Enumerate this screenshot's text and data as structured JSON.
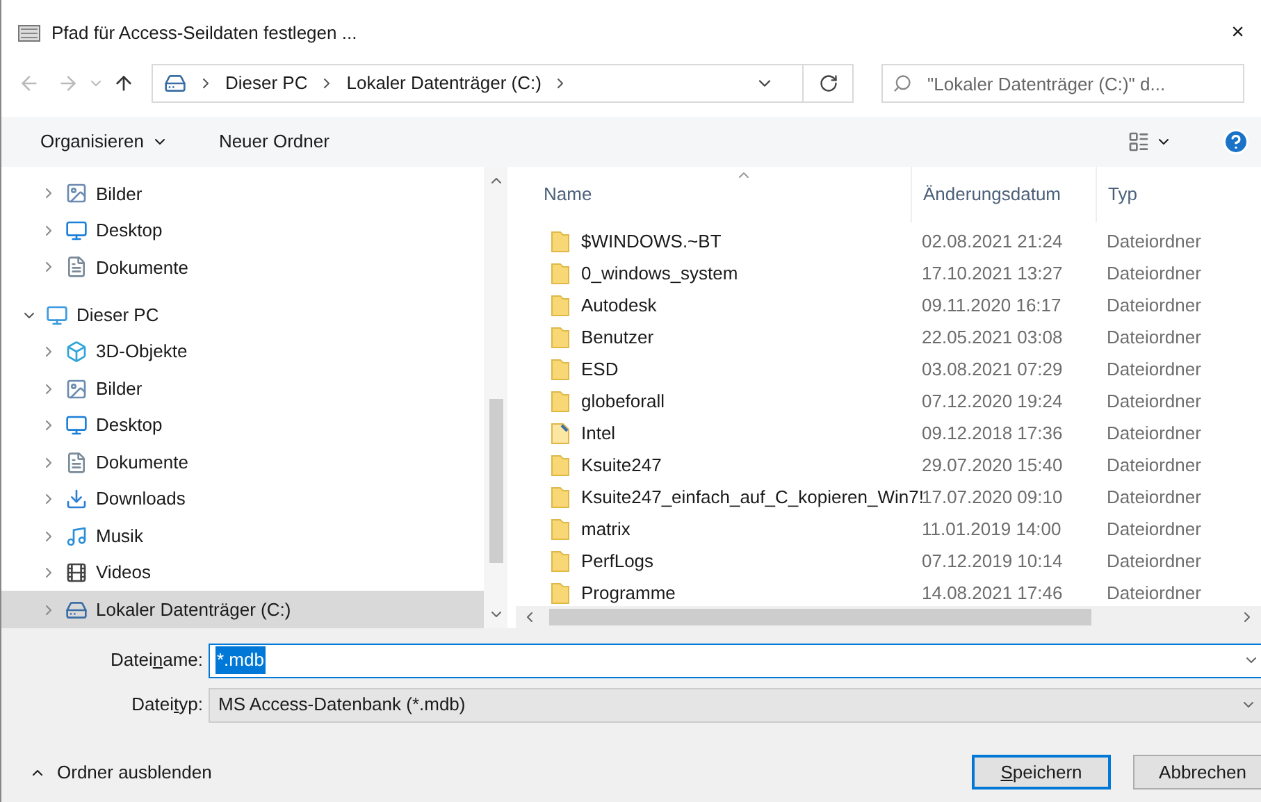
{
  "window": {
    "title": "Pfad für Access-Seildaten festlegen ...",
    "close": "×"
  },
  "address": {
    "crumbs": [
      "Dieser PC",
      "Lokaler Datenträger (C:)"
    ],
    "search_placeholder": "\"Lokaler Datenträger (C:)\" d..."
  },
  "toolbar": {
    "organize": "Organisieren",
    "new_folder": "Neuer Ordner"
  },
  "nav": {
    "continued_items": [
      {
        "label": "Bilder",
        "kind": "pictures",
        "selected": false
      },
      {
        "label": "Desktop",
        "kind": "desktop",
        "selected": false
      },
      {
        "label": "Dokumente",
        "kind": "documents",
        "selected": false
      }
    ],
    "items": [
      {
        "label": "Dieser PC",
        "kind": "pc",
        "expanded": true,
        "selected": false,
        "children": [
          {
            "label": "3D-Objekte",
            "kind": "objects",
            "selected": false
          },
          {
            "label": "Bilder",
            "kind": "pictures",
            "selected": false
          },
          {
            "label": "Desktop",
            "kind": "desktop",
            "selected": false
          },
          {
            "label": "Dokumente",
            "kind": "documents",
            "selected": false
          },
          {
            "label": "Downloads",
            "kind": "downloads",
            "selected": false
          },
          {
            "label": "Musik",
            "kind": "music",
            "selected": false
          },
          {
            "label": "Videos",
            "kind": "videos",
            "selected": false
          },
          {
            "label": "Lokaler Datenträger (C:)",
            "kind": "drive",
            "selected": true
          }
        ]
      }
    ]
  },
  "table": {
    "columns": [
      "Name",
      "Änderungsdatum",
      "Typ"
    ],
    "rows": [
      {
        "name": "$WINDOWS.~BT",
        "date": "02.08.2021 21:24",
        "type": "Dateiordner",
        "kind": "folder"
      },
      {
        "name": "0_windows_system",
        "date": "17.10.2021 13:27",
        "type": "Dateiordner",
        "kind": "folder"
      },
      {
        "name": "Autodesk",
        "date": "09.11.2020 16:17",
        "type": "Dateiordner",
        "kind": "folder"
      },
      {
        "name": "Benutzer",
        "date": "22.05.2021 03:08",
        "type": "Dateiordner",
        "kind": "folder"
      },
      {
        "name": "ESD",
        "date": "03.08.2021 07:29",
        "type": "Dateiordner",
        "kind": "folder"
      },
      {
        "name": "globeforall",
        "date": "07.12.2020 19:24",
        "type": "Dateiordner",
        "kind": "folder"
      },
      {
        "name": "Intel",
        "date": "09.12.2018 17:36",
        "type": "Dateiordner",
        "kind": "shortcut"
      },
      {
        "name": "Ksuite247",
        "date": "29.07.2020 15:40",
        "type": "Dateiordner",
        "kind": "folder"
      },
      {
        "name": "Ksuite247_einfach_auf_C_kopieren_Win7!",
        "date": "17.07.2020 09:10",
        "type": "Dateiordner",
        "kind": "folder"
      },
      {
        "name": "matrix",
        "date": "11.01.2019 14:00",
        "type": "Dateiordner",
        "kind": "folder"
      },
      {
        "name": "PerfLogs",
        "date": "07.12.2019 10:14",
        "type": "Dateiordner",
        "kind": "folder"
      },
      {
        "name": "Programme",
        "date": "14.08.2021 17:46",
        "type": "Dateiordner",
        "kind": "folder"
      }
    ]
  },
  "form": {
    "filename": {
      "label": {
        "before": "Datei",
        "key": "n",
        "after": "ame:"
      },
      "value": "*.mdb"
    },
    "filetype": {
      "label": {
        "before": "Datei",
        "key": "t",
        "after": "yp:"
      },
      "value": "MS Access-Datenbank (*.mdb)"
    }
  },
  "footer": {
    "hide_folders": "Ordner ausblenden",
    "save": {
      "key": "S",
      "after": "peichern"
    },
    "cancel": "Abbrechen"
  }
}
